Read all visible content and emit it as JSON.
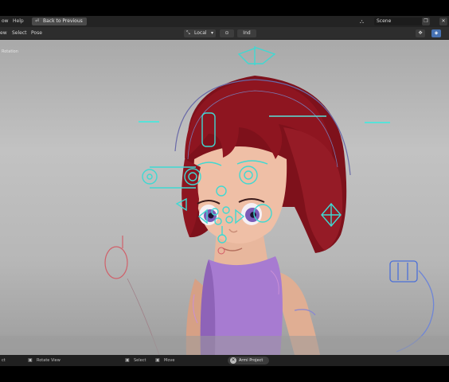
{
  "menubar": {
    "items": [
      "ow",
      "Help"
    ],
    "back_button_label": "Back to Previous",
    "scene_label": "Scene"
  },
  "header": {
    "mode_partial": "ew",
    "select_label": "Select",
    "pose_label": "Pose",
    "orientation_label": "Local",
    "pivot_label": "Ind"
  },
  "viewport": {
    "label": "Rotation"
  },
  "statusbar": {
    "left_partial": "ct",
    "rotate_label": "Rotate View",
    "select_label": "Select",
    "move_label": "Move",
    "active_object": "Armi Project"
  },
  "colors": {
    "rig": "#3fd9d2",
    "hair": "#8e1520",
    "dress": "#a77bd1",
    "skin": "#e6b49a",
    "accent": "#4772b3"
  }
}
